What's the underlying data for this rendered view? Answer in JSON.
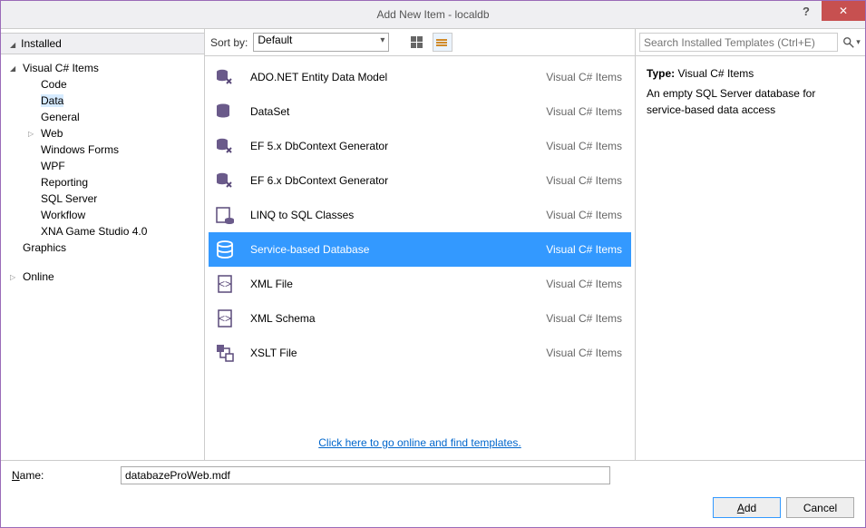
{
  "title": "Add New Item - localdb",
  "sidebar": {
    "header": "Installed",
    "tree": [
      {
        "label": "Visual C# Items",
        "expanded": true,
        "children": [
          {
            "label": "Code"
          },
          {
            "label": "Data",
            "selected": true
          },
          {
            "label": "General"
          },
          {
            "label": "Web",
            "hasChildren": true
          },
          {
            "label": "Windows Forms"
          },
          {
            "label": "WPF"
          },
          {
            "label": "Reporting"
          },
          {
            "label": "SQL Server"
          },
          {
            "label": "Workflow"
          },
          {
            "label": "XNA Game Studio 4.0"
          }
        ]
      },
      {
        "label": "Graphics"
      }
    ],
    "online": "Online"
  },
  "toolbar": {
    "sort_label": "Sort by:",
    "sort_value": "Default"
  },
  "items": [
    {
      "name": "ADO.NET Entity Data Model",
      "cat": "Visual C# Items",
      "icon": "entity"
    },
    {
      "name": "DataSet",
      "cat": "Visual C# Items",
      "icon": "dataset"
    },
    {
      "name": "EF 5.x DbContext Generator",
      "cat": "Visual C# Items",
      "icon": "ef"
    },
    {
      "name": "EF 6.x DbContext Generator",
      "cat": "Visual C# Items",
      "icon": "ef"
    },
    {
      "name": "LINQ to SQL Classes",
      "cat": "Visual C# Items",
      "icon": "linq"
    },
    {
      "name": "Service-based Database",
      "cat": "Visual C# Items",
      "icon": "db",
      "selected": true
    },
    {
      "name": "XML File",
      "cat": "Visual C# Items",
      "icon": "xml"
    },
    {
      "name": "XML Schema",
      "cat": "Visual C# Items",
      "icon": "xsd"
    },
    {
      "name": "XSLT File",
      "cat": "Visual C# Items",
      "icon": "xslt"
    }
  ],
  "online_link": "Click here to go online and find templates.",
  "search": {
    "placeholder": "Search Installed Templates (Ctrl+E)"
  },
  "details": {
    "type_label": "Type:",
    "type_value": "Visual C# Items",
    "description": "An empty SQL Server database for service-based data access"
  },
  "footer": {
    "name_label": "Name:",
    "name_value": "databazeProWeb.mdf",
    "add": "Add",
    "cancel": "Cancel"
  }
}
